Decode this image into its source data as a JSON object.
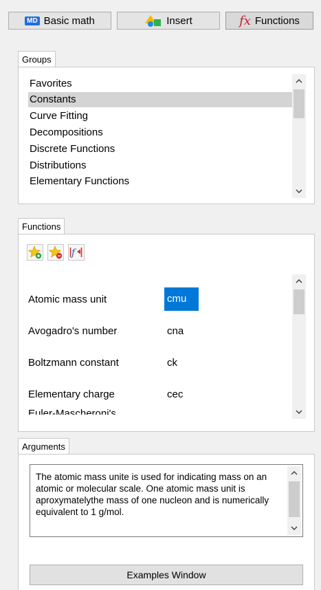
{
  "toolbar": {
    "basic_math": "Basic math",
    "basic_math_badge": "MD",
    "insert": "Insert",
    "functions": "Functions",
    "functions_badge": "fx"
  },
  "groups": {
    "tab_label": "Groups",
    "items": [
      "Favorites",
      "Constants",
      "Curve Fitting",
      "Decompositions",
      "Discrete Functions",
      "Distributions",
      "Elementary Functions"
    ],
    "selected": "Constants"
  },
  "functions": {
    "tab_label": "Functions",
    "tools": [
      "add-favorite-icon",
      "remove-favorite-icon",
      "insert-function-icon"
    ],
    "rows": [
      {
        "name": "Atomic mass unit",
        "code": "cmu"
      },
      {
        "name": "Avogadro's number",
        "code": "cna"
      },
      {
        "name": "Boltzmann constant",
        "code": "ck"
      },
      {
        "name": "Elementary charge",
        "code": "cec"
      },
      {
        "name": "Euler-Mascheroni's",
        "code": ""
      }
    ],
    "selected_code": "cmu"
  },
  "arguments": {
    "tab_label": "Arguments",
    "description": "The atomic mass unite is used for indicating mass on an atomic or molecular scale. One atomic mass unit is aproxymatelythe mass of one nucleon and is numerically equivalent to 1 g/mol.",
    "examples_button": "Examples Window"
  },
  "colors": {
    "selection_blue": "#0078d7",
    "selection_gray": "#d4d4d4"
  }
}
